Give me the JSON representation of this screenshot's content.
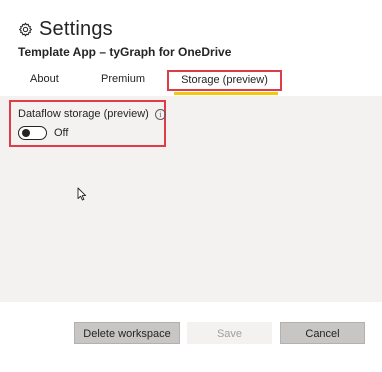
{
  "header": {
    "title": "Settings",
    "subtitle": "Template App – tyGraph for OneDrive",
    "icon": "gear-icon"
  },
  "tabs": [
    {
      "label": "About",
      "selected": false
    },
    {
      "label": "Premium",
      "selected": false
    },
    {
      "label": "Storage (preview)",
      "selected": true
    }
  ],
  "storage": {
    "field_label": "Dataflow storage (preview)",
    "info_icon": "info-icon",
    "info_glyph": "i",
    "toggle_state": "Off",
    "toggle_on": false
  },
  "buttons": {
    "delete_label": "Delete workspace",
    "save_label": "Save",
    "cancel_label": "Cancel"
  },
  "colors": {
    "highlight": "#e03c47",
    "tab_underline": "#f2c811",
    "panel_bg": "#f3f2f1",
    "button_bg": "#c8c6c4"
  }
}
